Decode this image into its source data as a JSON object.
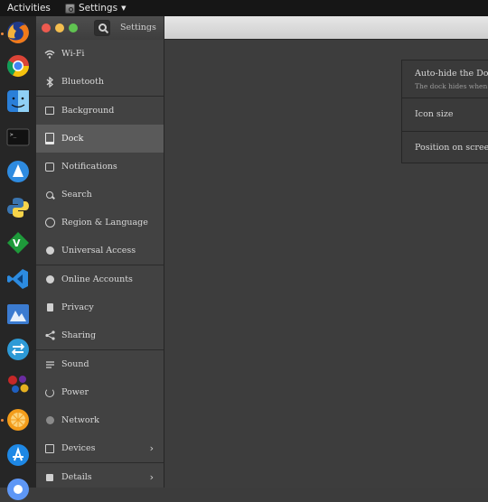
{
  "topbar": {
    "activities": "Activities",
    "app_menu": "Settings"
  },
  "window": {
    "title": "Settings"
  },
  "sidebar": {
    "items": [
      {
        "label": "Wi-Fi",
        "icon": "wifi-icon"
      },
      {
        "label": "Bluetooth",
        "icon": "bluetooth-icon"
      },
      {
        "label": "Background",
        "icon": "background-icon"
      },
      {
        "label": "Dock",
        "icon": "dock-icon"
      },
      {
        "label": "Notifications",
        "icon": "notifications-icon"
      },
      {
        "label": "Search",
        "icon": "search-icon"
      },
      {
        "label": "Region & Language",
        "icon": "globe-icon"
      },
      {
        "label": "Universal Access",
        "icon": "universal-access-icon"
      },
      {
        "label": "Online Accounts",
        "icon": "online-accounts-icon"
      },
      {
        "label": "Privacy",
        "icon": "privacy-icon"
      },
      {
        "label": "Sharing",
        "icon": "share-icon"
      },
      {
        "label": "Sound",
        "icon": "sound-icon"
      },
      {
        "label": "Power",
        "icon": "power-icon"
      },
      {
        "label": "Network",
        "icon": "network-icon"
      },
      {
        "label": "Devices",
        "icon": "devices-icon"
      },
      {
        "label": "Details",
        "icon": "details-icon"
      }
    ],
    "selected": "Dock"
  },
  "dock_panel": {
    "autohide_title": "Auto-hide the Dock",
    "autohide_subtitle": "The dock hides when an",
    "icon_size_label": "Icon size",
    "position_label": "Position on screen"
  },
  "launcher": {
    "apps": [
      "firefox-icon",
      "chrome-icon",
      "finder-icon",
      "terminal-icon",
      "app-store-sail-icon",
      "python-icon",
      "vim-icon",
      "vscode-icon",
      "preview-icon",
      "router-icon",
      "colored-dots-icon",
      "orange-icon",
      "app-store-icon",
      "chromium-icon"
    ]
  },
  "colors": {
    "sidebar_bg": "#424242",
    "selected_bg": "#5a5a5a",
    "main_bg": "#3d3d3d",
    "close": "#ed5a4f",
    "minimize": "#f4be4f",
    "maximize": "#60c351"
  }
}
